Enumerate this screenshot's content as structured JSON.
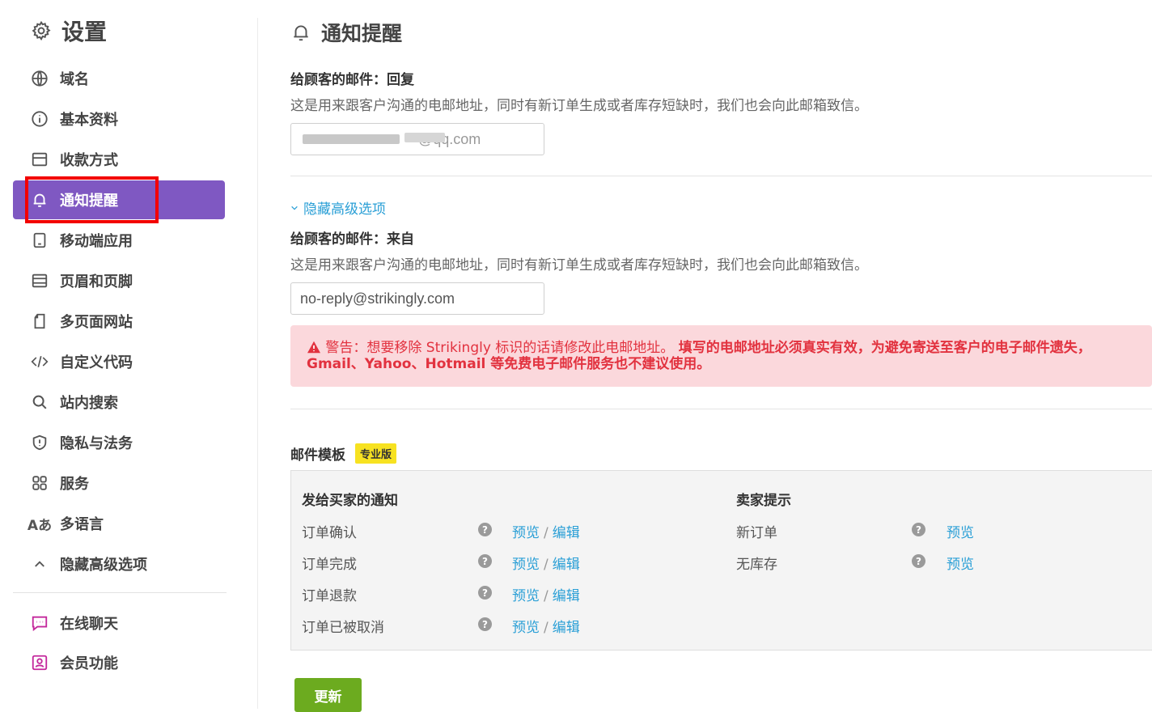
{
  "sidebar": {
    "title": "设置",
    "items": [
      {
        "label": "域名",
        "icon": "globe-icon"
      },
      {
        "label": "基本资料",
        "icon": "info-icon"
      },
      {
        "label": "收款方式",
        "icon": "wallet-icon"
      },
      {
        "label": "通知提醒",
        "icon": "bell-icon",
        "active": true
      },
      {
        "label": "移动端应用",
        "icon": "mobile-icon"
      },
      {
        "label": "页眉和页脚",
        "icon": "layout-icon"
      },
      {
        "label": "多页面网站",
        "icon": "pages-icon"
      },
      {
        "label": "自定义代码",
        "icon": "code-icon"
      },
      {
        "label": "站内搜索",
        "icon": "search-icon"
      },
      {
        "label": "隐私与法务",
        "icon": "shield-icon"
      },
      {
        "label": "服务",
        "icon": "grid-icon"
      },
      {
        "label": "多语言",
        "icon": "language-icon"
      },
      {
        "label": "隐藏高级选项",
        "icon": "chevron-up-icon"
      }
    ],
    "extra_items": [
      {
        "label": "在线聊天",
        "icon": "chat-icon"
      },
      {
        "label": "会员功能",
        "icon": "member-icon"
      }
    ],
    "active_color": "#7f58c2",
    "highlight_color": "#f30000"
  },
  "main": {
    "title": "通知提醒",
    "reply_field": {
      "label": "给顾客的邮件：回复",
      "description": "这是用来跟客户沟通的电邮地址，同时有新订单生成或者库存短缺时，我们也会向此邮箱致信。",
      "value": "·@qq.com"
    },
    "advanced_toggle": "隐藏高级选项",
    "from_field": {
      "label": "给顾客的邮件：来自",
      "description": "这是用来跟客户沟通的电邮地址，同时有新订单生成或者库存短缺时，我们也会向此邮箱致信。",
      "value": "no-reply@strikingly.com"
    },
    "alert": {
      "prefix": "警告：想要移除 Strikingly 标识的话请修改此电邮地址。",
      "strong": "填写的电邮地址必须真实有效，为避免寄送至客户的电子邮件遗失，Gmail、Yahoo、Hotmail 等免费电子邮件服务也不建议使用。",
      "color": "#e2323f"
    },
    "templates": {
      "title": "邮件模板",
      "badge": "专业版",
      "buyer_heading": "发给买家的通知",
      "seller_heading": "卖家提示",
      "preview_label": "预览",
      "edit_label": "编辑",
      "link_separator": "/",
      "help_symbol": "?",
      "buyer_rows": [
        {
          "name": "订单确认"
        },
        {
          "name": "订单完成"
        },
        {
          "name": "订单退款"
        },
        {
          "name": "订单已被取消"
        }
      ],
      "seller_rows": [
        {
          "name": "新订单"
        },
        {
          "name": "无库存"
        }
      ]
    },
    "update_button": "更新",
    "accent_link_color": "#2a9fd6",
    "button_color": "#6cab1f"
  }
}
